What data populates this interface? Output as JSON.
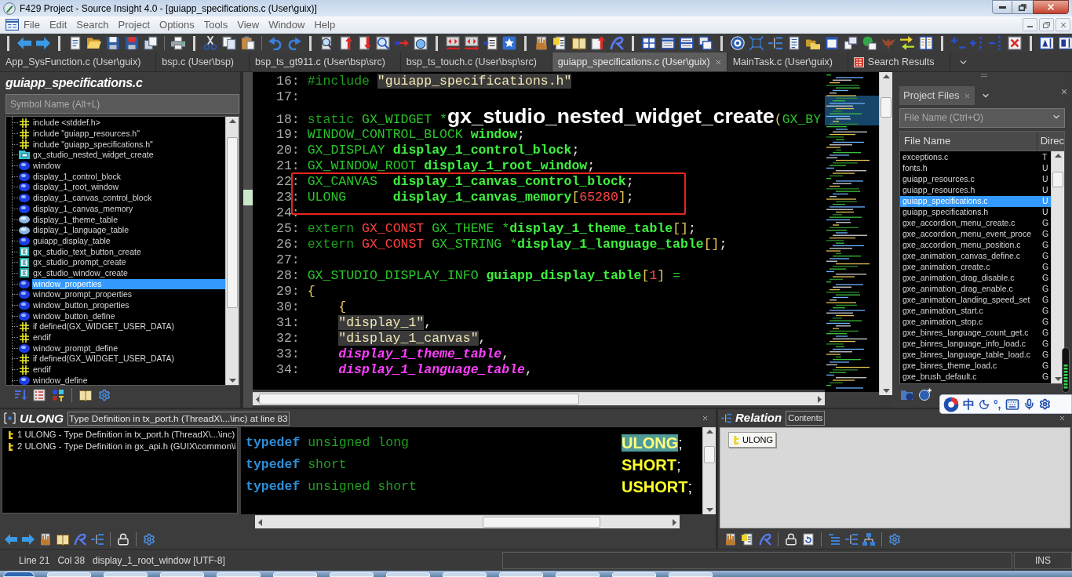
{
  "window": {
    "title": "F429 Project - Source Insight 4.0 - [guiapp_specifications.c (User\\guix)]"
  },
  "menu": [
    "File",
    "Edit",
    "Search",
    "Project",
    "Options",
    "Tools",
    "View",
    "Window",
    "Help"
  ],
  "tabs": [
    {
      "label": "App_SysFunction.c (User\\guix)",
      "kind": "file",
      "selected": false
    },
    {
      "label": "bsp.c (User\\bsp)",
      "kind": "file",
      "selected": false
    },
    {
      "label": "bsp_ts_gt911.c (User\\bsp\\src)",
      "kind": "file",
      "selected": false
    },
    {
      "label": "bsp_ts_touch.c (User\\bsp\\src)",
      "kind": "file",
      "selected": false
    },
    {
      "label": "guiapp_specifications.c (User\\guix)",
      "kind": "file",
      "selected": true
    },
    {
      "label": "MainTask.c (User\\guix)",
      "kind": "file",
      "selected": false
    },
    {
      "label": "Search Results",
      "kind": "search",
      "selected": false
    }
  ],
  "symbol_panel": {
    "title": "guiapp_specifications.c",
    "search": {
      "placeholder": "Symbol Name (Alt+L)"
    },
    "symbols": [
      {
        "label": "include <stddef.h>",
        "kind": "preprocessor",
        "selected": false
      },
      {
        "label": "include \"guiapp_resources.h\"",
        "kind": "preprocessor",
        "selected": false
      },
      {
        "label": "include \"guiapp_specifications.h\"",
        "kind": "preprocessor",
        "selected": false
      },
      {
        "label": "gx_studio_nested_widget_create",
        "kind": "prototype",
        "selected": false
      },
      {
        "label": "window",
        "kind": "variable",
        "selected": false
      },
      {
        "label": "display_1_control_block",
        "kind": "variable",
        "selected": false
      },
      {
        "label": "display_1_root_window",
        "kind": "variable",
        "selected": false
      },
      {
        "label": "display_1_canvas_control_block",
        "kind": "variable",
        "selected": false
      },
      {
        "label": "display_1_canvas_memory",
        "kind": "variable",
        "selected": false
      },
      {
        "label": "display_1_theme_table",
        "kind": "extern",
        "selected": false
      },
      {
        "label": "display_1_language_table",
        "kind": "extern",
        "selected": false
      },
      {
        "label": "guiapp_display_table",
        "kind": "variable",
        "selected": false
      },
      {
        "label": "gx_studio_text_button_create",
        "kind": "function",
        "selected": false
      },
      {
        "label": "gx_studio_prompt_create",
        "kind": "function",
        "selected": false
      },
      {
        "label": "gx_studio_window_create",
        "kind": "function",
        "selected": false
      },
      {
        "label": "window_properties",
        "kind": "variable",
        "selected": true
      },
      {
        "label": "window_prompt_properties",
        "kind": "variable",
        "selected": false
      },
      {
        "label": "window_button_properties",
        "kind": "variable",
        "selected": false
      },
      {
        "label": "window_button_define",
        "kind": "variable",
        "selected": false
      },
      {
        "label": "if defined(GX_WIDGET_USER_DATA)",
        "kind": "preprocessor",
        "selected": false
      },
      {
        "label": "endif",
        "kind": "preprocessor",
        "selected": false
      },
      {
        "label": "window_prompt_define",
        "kind": "variable",
        "selected": false
      },
      {
        "label": "if defined(GX_WIDGET_USER_DATA)",
        "kind": "preprocessor",
        "selected": false
      },
      {
        "label": "endif",
        "kind": "preprocessor",
        "selected": false
      },
      {
        "label": "window_define",
        "kind": "variable",
        "selected": false
      }
    ]
  },
  "editor": {
    "lines": [
      {
        "number": "16:",
        "boxed": false,
        "marked": false,
        "indented": false,
        "tokens": [
          {
            "text": "#include ",
            "kind": "keyword"
          },
          {
            "text": "\"guiapp_specifications.h\"",
            "kind": "string"
          }
        ]
      },
      {
        "number": "17:",
        "boxed": false,
        "marked": false
      },
      {
        "number": "18:",
        "boxed": false,
        "marked": false,
        "indented": false,
        "tokens": [
          {
            "text": "static ",
            "kind": "keyword"
          },
          {
            "text": "GX_WIDGET *",
            "kind": "type"
          },
          {
            "text": "gx_studio_nested_widget_create",
            "kind": "declaration"
          },
          {
            "text": "(",
            "kind": "punct"
          },
          {
            "text": "GX_BY",
            "kind": "type"
          }
        ]
      },
      {
        "number": "19:",
        "boxed": false,
        "marked": false,
        "indented": false,
        "tokens": [
          {
            "text": "WINDOW_CONTROL_BLOCK ",
            "kind": "type"
          },
          {
            "text": "window",
            "kind": "name"
          },
          {
            "text": ";",
            "kind": "plain"
          }
        ]
      },
      {
        "number": "20:",
        "boxed": false,
        "marked": false,
        "indented": false,
        "tokens": [
          {
            "text": "GX_DISPLAY ",
            "kind": "type"
          },
          {
            "text": "display_1_control_block",
            "kind": "name"
          },
          {
            "text": ";",
            "kind": "plain"
          }
        ]
      },
      {
        "number": "21:",
        "boxed": false,
        "marked": false,
        "indented": false,
        "tokens": [
          {
            "text": "GX_WINDOW_ROOT ",
            "kind": "type"
          },
          {
            "text": "display_1_root_window",
            "kind": "name"
          },
          {
            "text": ";",
            "kind": "plain"
          }
        ]
      },
      {
        "number": "22:",
        "boxed": true,
        "marked": false,
        "indented": false,
        "tokens": [
          {
            "text": "GX_CANVAS  ",
            "kind": "type"
          },
          {
            "text": "display_1_canvas_control_block",
            "kind": "name"
          },
          {
            "text": ";",
            "kind": "plain"
          }
        ]
      },
      {
        "number": "23:",
        "boxed": true,
        "marked": true,
        "indented": false,
        "tokens": [
          {
            "text": "ULONG      ",
            "kind": "type"
          },
          {
            "text": "display_1_canvas_memory",
            "kind": "name"
          },
          {
            "text": "[",
            "kind": "punct"
          },
          {
            "text": "65280",
            "kind": "number"
          },
          {
            "text": "]",
            "kind": "punct"
          },
          {
            "text": ";",
            "kind": "plain"
          }
        ]
      },
      {
        "number": "24:",
        "boxed": false,
        "marked": false
      },
      {
        "number": "25:",
        "boxed": false,
        "marked": false,
        "indented": false,
        "tokens": [
          {
            "text": "extern ",
            "kind": "keyword"
          },
          {
            "text": "GX_CONST ",
            "kind": "macro"
          },
          {
            "text": "GX_THEME *",
            "kind": "type"
          },
          {
            "text": "display_1_theme_table",
            "kind": "name"
          },
          {
            "text": "[]",
            "kind": "punct"
          },
          {
            "text": ";",
            "kind": "plain"
          }
        ]
      },
      {
        "number": "26:",
        "boxed": false,
        "marked": false,
        "indented": false,
        "tokens": [
          {
            "text": "extern ",
            "kind": "keyword"
          },
          {
            "text": "GX_CONST ",
            "kind": "macro"
          },
          {
            "text": "GX_STRING *",
            "kind": "type"
          },
          {
            "text": "display_1_language_table",
            "kind": "name"
          },
          {
            "text": "[]",
            "kind": "punct"
          },
          {
            "text": ";",
            "kind": "plain"
          }
        ]
      },
      {
        "number": "27:",
        "boxed": false,
        "marked": false
      },
      {
        "number": "28:",
        "boxed": false,
        "marked": false,
        "indented": false,
        "tokens": [
          {
            "text": "GX_STUDIO_DISPLAY_INFO ",
            "kind": "type"
          },
          {
            "text": "guiapp_display_table",
            "kind": "name"
          },
          {
            "text": "[",
            "kind": "punct"
          },
          {
            "text": "1",
            "kind": "number"
          },
          {
            "text": "]",
            "kind": "punct"
          },
          {
            "text": " =",
            "kind": "type"
          }
        ]
      },
      {
        "number": "29:",
        "boxed": false,
        "marked": false,
        "indented": false,
        "tokens": [
          {
            "text": "{",
            "kind": "punct"
          }
        ]
      },
      {
        "number": "30:",
        "boxed": false,
        "marked": false,
        "indented": true,
        "tokens": [
          {
            "text": "{",
            "kind": "punct"
          }
        ]
      },
      {
        "number": "31:",
        "boxed": false,
        "marked": false,
        "indented": true,
        "tokens": [
          {
            "text": "\"display_1\"",
            "kind": "string"
          },
          {
            "text": ",",
            "kind": "plain"
          }
        ]
      },
      {
        "number": "32:",
        "boxed": false,
        "marked": false,
        "indented": true,
        "tokens": [
          {
            "text": "\"display_1_canvas\"",
            "kind": "string"
          },
          {
            "text": ",",
            "kind": "plain"
          }
        ]
      },
      {
        "number": "33:",
        "boxed": false,
        "marked": false,
        "indented": true,
        "tokens": [
          {
            "text": "display_1_theme_table",
            "kind": "param"
          },
          {
            "text": ",",
            "kind": "plain"
          }
        ]
      },
      {
        "number": "34:",
        "boxed": false,
        "marked": false,
        "indented": true,
        "tokens": [
          {
            "text": "display_1_language_table",
            "kind": "param"
          },
          {
            "text": ",",
            "kind": "plain"
          }
        ]
      }
    ]
  },
  "project_panel": {
    "tab": "Project Files",
    "search": {
      "placeholder": "File Name (Ctrl+O)"
    },
    "columns": [
      "File Name",
      "Direc"
    ],
    "files": [
      {
        "name": "exceptions.c",
        "dir": "T",
        "selected": false
      },
      {
        "name": "fonts.h",
        "dir": "U",
        "selected": false
      },
      {
        "name": "guiapp_resources.c",
        "dir": "U",
        "selected": false
      },
      {
        "name": "guiapp_resources.h",
        "dir": "U",
        "selected": false
      },
      {
        "name": "guiapp_specifications.c",
        "dir": "U",
        "selected": true
      },
      {
        "name": "guiapp_specifications.h",
        "dir": "U",
        "selected": false
      },
      {
        "name": "gxe_accordion_menu_create.c",
        "dir": "G",
        "selected": false
      },
      {
        "name": "gxe_accordion_menu_event_proce",
        "dir": "G",
        "selected": false
      },
      {
        "name": "gxe_accordion_menu_position.c",
        "dir": "G",
        "selected": false
      },
      {
        "name": "gxe_animation_canvas_define.c",
        "dir": "G",
        "selected": false
      },
      {
        "name": "gxe_animation_create.c",
        "dir": "G",
        "selected": false
      },
      {
        "name": "gxe_animation_drag_disable.c",
        "dir": "G",
        "selected": false
      },
      {
        "name": "gxe_animation_drag_enable.c",
        "dir": "G",
        "selected": false
      },
      {
        "name": "gxe_animation_landing_speed_set",
        "dir": "G",
        "selected": false
      },
      {
        "name": "gxe_animation_start.c",
        "dir": "G",
        "selected": false
      },
      {
        "name": "gxe_animation_stop.c",
        "dir": "G",
        "selected": false
      },
      {
        "name": "gxe_binres_language_count_get.c",
        "dir": "G",
        "selected": false
      },
      {
        "name": "gxe_binres_language_info_load.c",
        "dir": "G",
        "selected": false
      },
      {
        "name": "gxe_binres_language_table_load.c",
        "dir": "G",
        "selected": false
      },
      {
        "name": "gxe_binres_theme_load.c",
        "dir": "G",
        "selected": false
      },
      {
        "name": "gxe_brush_default.c",
        "dir": "G",
        "selected": false
      }
    ]
  },
  "definition_panel": {
    "symbol": "ULONG",
    "description": "Type Definition in tx_port.h (ThreadX\\...\\inc) at line 83",
    "references": [
      {
        "label": "1 ULONG - Type Definition in tx_port.h (ThreadX\\...\\inc)"
      },
      {
        "label": "2 ULONG - Type Definition in gx_api.h (GUIX\\common\\i"
      }
    ]
  },
  "preview": {
    "lines": [
      {
        "keyword": "typedef",
        "base": "unsigned long",
        "name": "ULONG",
        "punct": ";",
        "highlighted": true
      },
      {
        "keyword": "typedef",
        "base": "short",
        "name": "SHORT",
        "punct": ";",
        "highlighted": false
      },
      {
        "keyword": "typedef",
        "base": "unsigned short",
        "name": "USHORT",
        "punct": ";",
        "highlighted": false
      }
    ]
  },
  "relation_panel": {
    "title": "Relation",
    "subtitle": "Contents",
    "nodes": [
      {
        "label": "ULONG"
      }
    ]
  },
  "status_bar": {
    "items": [
      "Line 21",
      "Col 38",
      "display_1_root_window [UTF-8]"
    ],
    "mode": "INS"
  },
  "ime_bar": {
    "mode": "中",
    "punctuation": "°,"
  }
}
